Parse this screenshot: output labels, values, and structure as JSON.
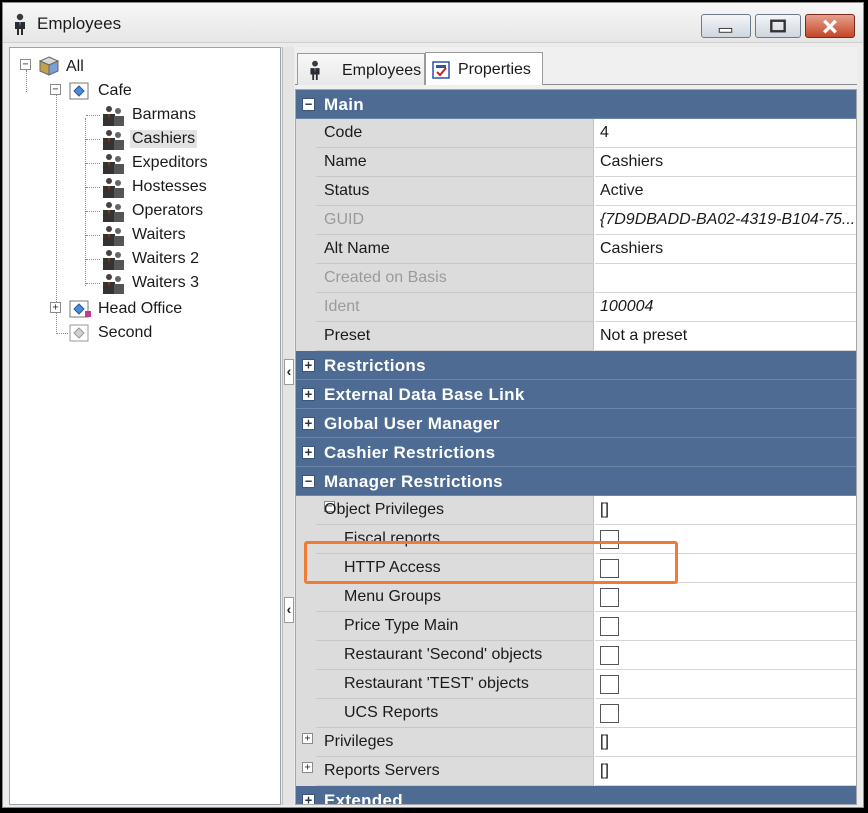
{
  "window": {
    "title": "Employees",
    "controls": {
      "minimize": "minimize-icon",
      "maximize": "maximize-icon",
      "close": "close-icon"
    }
  },
  "tree": {
    "root": "All",
    "items": [
      {
        "label": "Cafe",
        "children": [
          "Barmans",
          "Cashiers",
          "Expeditors",
          "Hostesses",
          "Operators",
          "Waiters",
          "Waiters 2",
          "Waiters 3"
        ]
      },
      {
        "label": "Head Office"
      },
      {
        "label": "Second"
      }
    ],
    "selected": "Cashiers"
  },
  "tabs": [
    {
      "label": "Employees",
      "icon": "employee-icon"
    },
    {
      "label": "Properties",
      "icon": "properties-icon",
      "active": true
    }
  ],
  "grid": {
    "main": {
      "label": "Main",
      "rows": [
        {
          "name": "Code",
          "value": "4"
        },
        {
          "name": "Name",
          "value": "Cashiers"
        },
        {
          "name": "Status",
          "value": "Active"
        },
        {
          "name": "GUID",
          "value": "{7D9DBADD-BA02-4319-B104-75..."
        },
        {
          "name": "Alt Name",
          "value": "Cashiers"
        },
        {
          "name": "Created on Basis",
          "value": ""
        },
        {
          "name": "Ident",
          "value": "100004"
        },
        {
          "name": "Preset",
          "value": "Not a preset"
        }
      ]
    },
    "categories": [
      "Restrictions",
      "External Data Base Link",
      "Global User Manager",
      "Cashier Restrictions"
    ],
    "manager": {
      "label": "Manager Restrictions",
      "object_privileges": {
        "name": "Object Privileges",
        "value": "[]"
      },
      "items": [
        "Fiscal reports",
        "HTTP Access",
        "Menu Groups",
        "Price Type Main",
        "Restaurant 'Second' objects",
        "Restaurant 'TEST' objects",
        "UCS Reports"
      ],
      "privileges": {
        "name": "Privileges",
        "value": "[]"
      },
      "reports_servers": {
        "name": "Reports Servers",
        "value": "[]"
      }
    },
    "extended": "Extended"
  },
  "colors": {
    "category_header": "#4e6b93",
    "highlight": "#f07b35"
  }
}
